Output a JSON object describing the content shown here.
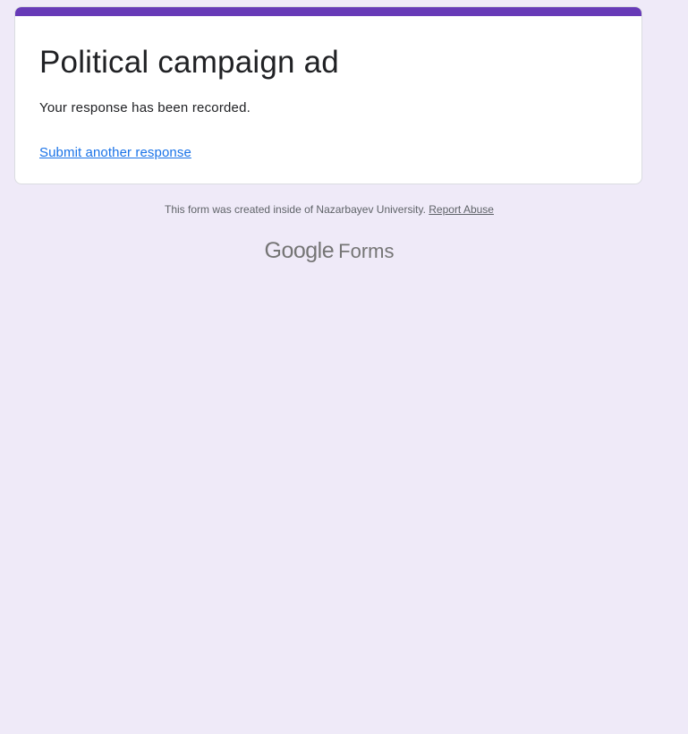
{
  "form": {
    "title": "Political campaign ad",
    "confirmation_message": "Your response has been recorded.",
    "submit_another_label": "Submit another response"
  },
  "footer": {
    "note": "This form was created inside of Nazarbayev University.",
    "report_abuse_label": "Report Abuse"
  },
  "brand": {
    "google": "Google",
    "product": "Forms"
  },
  "colors": {
    "accent": "#673ab7",
    "background": "#efeaf8",
    "link": "#1a73e8"
  }
}
